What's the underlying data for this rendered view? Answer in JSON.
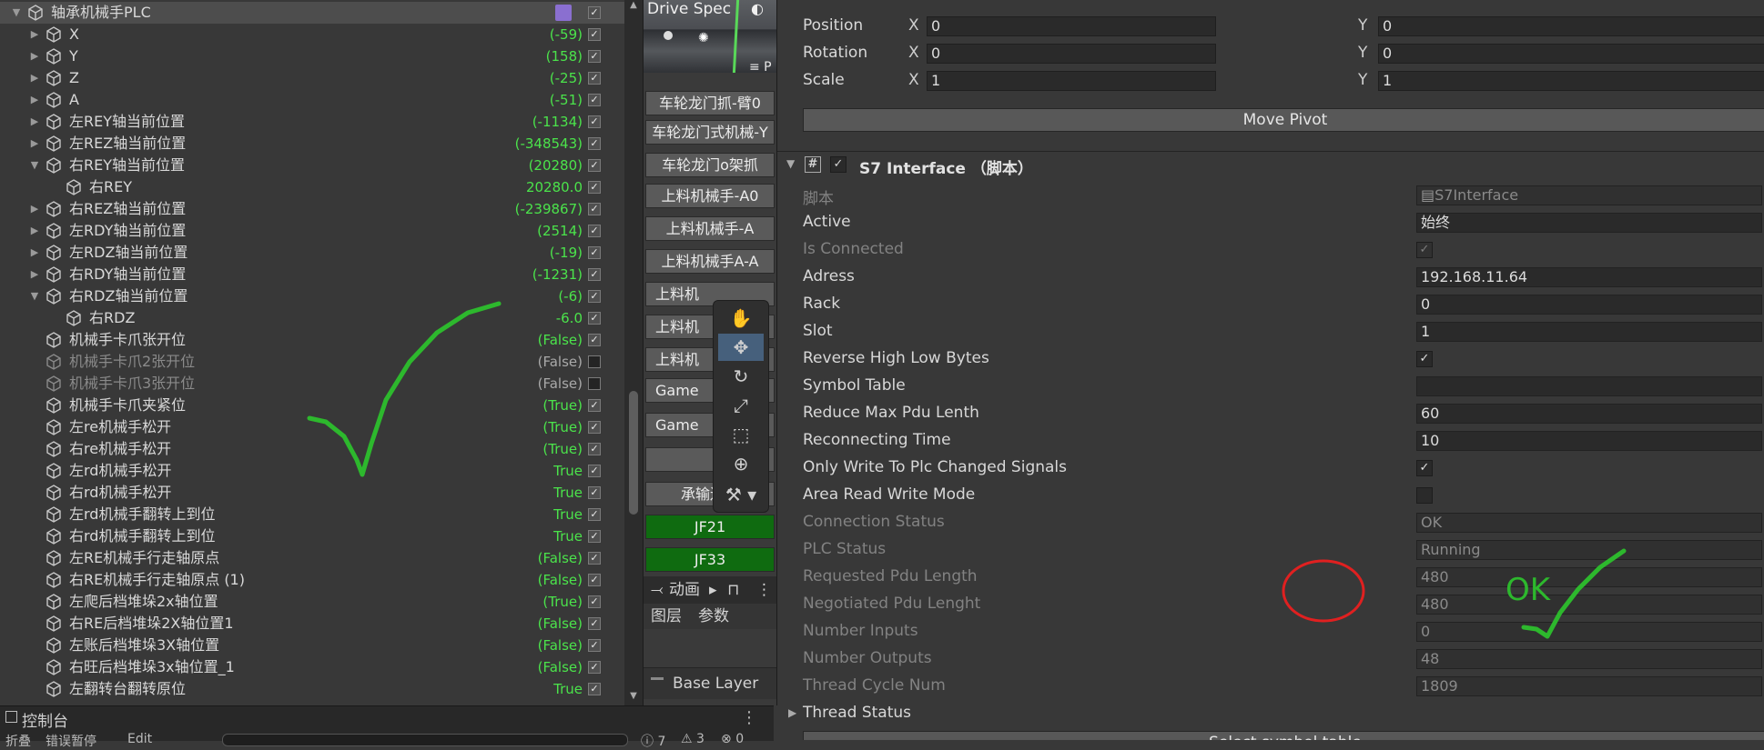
{
  "hierarchy": {
    "root": "轴承机械手PLC",
    "rows": [
      {
        "name": "X",
        "value": "(-59)",
        "checked": true,
        "depth": 1,
        "fold": "closed"
      },
      {
        "name": "Y",
        "value": "(158)",
        "checked": true,
        "depth": 1,
        "fold": "closed"
      },
      {
        "name": "Z",
        "value": "(-25)",
        "checked": true,
        "depth": 1,
        "fold": "closed"
      },
      {
        "name": "A",
        "value": "(-51)",
        "checked": true,
        "depth": 1,
        "fold": "closed"
      },
      {
        "name": "左REY轴当前位置",
        "value": "(-1134)",
        "checked": true,
        "depth": 1,
        "fold": "closed"
      },
      {
        "name": "左REZ轴当前位置",
        "value": "(-348543)",
        "checked": true,
        "depth": 1,
        "fold": "closed"
      },
      {
        "name": "右REY轴当前位置",
        "value": "(20280)",
        "checked": true,
        "depth": 1,
        "fold": "open"
      },
      {
        "name": "右REY",
        "value": "20280.0",
        "checked": true,
        "depth": 2,
        "fold": "none"
      },
      {
        "name": "右REZ轴当前位置",
        "value": "(-239867)",
        "checked": true,
        "depth": 1,
        "fold": "closed"
      },
      {
        "name": "左RDY轴当前位置",
        "value": "(2514)",
        "checked": true,
        "depth": 1,
        "fold": "closed"
      },
      {
        "name": "左RDZ轴当前位置",
        "value": "(-19)",
        "checked": true,
        "depth": 1,
        "fold": "closed"
      },
      {
        "name": "右RDY轴当前位置",
        "value": "(-1231)",
        "checked": true,
        "depth": 1,
        "fold": "closed"
      },
      {
        "name": "右RDZ轴当前位置",
        "value": "(-6)",
        "checked": true,
        "depth": 1,
        "fold": "open"
      },
      {
        "name": "右RDZ",
        "value": "-6.0",
        "checked": true,
        "depth": 2,
        "fold": "none"
      },
      {
        "name": "机械手卡爪张开位",
        "value": "(False)",
        "checked": true,
        "depth": 1,
        "fold": "none"
      },
      {
        "name": "机械手卡爪2张开位",
        "value": "(False)",
        "checked": false,
        "depth": 1,
        "fold": "none",
        "dim": true
      },
      {
        "name": "机械手卡爪3张开位",
        "value": "(False)",
        "checked": false,
        "depth": 1,
        "fold": "none",
        "dim": true
      },
      {
        "name": "机械手卡爪夹紧位",
        "value": "(True)",
        "checked": true,
        "depth": 1,
        "fold": "none"
      },
      {
        "name": "左re机械手松开",
        "value": "(True)",
        "checked": true,
        "depth": 1,
        "fold": "none"
      },
      {
        "name": "右re机械手松开",
        "value": "(True)",
        "checked": true,
        "depth": 1,
        "fold": "none"
      },
      {
        "name": "左rd机械手松开",
        "value": "True",
        "checked": true,
        "depth": 1,
        "fold": "none"
      },
      {
        "name": "右rd机械手松开",
        "value": "True",
        "checked": true,
        "depth": 1,
        "fold": "none"
      },
      {
        "name": "左rd机械手翻转上到位",
        "value": "True",
        "checked": true,
        "depth": 1,
        "fold": "none"
      },
      {
        "name": "右rd机械手翻转上到位",
        "value": "True",
        "checked": true,
        "depth": 1,
        "fold": "none"
      },
      {
        "name": "左RE机械手行走轴原点",
        "value": "(False)",
        "checked": true,
        "depth": 1,
        "fold": "none"
      },
      {
        "name": "右RE机械手行走轴原点 (1)",
        "value": "(False)",
        "checked": true,
        "depth": 1,
        "fold": "none"
      },
      {
        "name": "左爬后档堆垛2x轴位置",
        "value": "(True)",
        "checked": true,
        "depth": 1,
        "fold": "none"
      },
      {
        "name": "右RE后档堆垛2X轴位置1",
        "value": "(False)",
        "checked": true,
        "depth": 1,
        "fold": "none"
      },
      {
        "name": "左账后档堆垛3X轴位置",
        "value": "(False)",
        "checked": true,
        "depth": 1,
        "fold": "none"
      },
      {
        "name": "右旺后档堆垛3x轴位置_1",
        "value": "(False)",
        "checked": true,
        "depth": 1,
        "fold": "none"
      },
      {
        "name": "左翻转台翻转原位",
        "value": "True",
        "checked": true,
        "depth": 1,
        "fold": "none"
      }
    ]
  },
  "console": {
    "title": "控制台",
    "tools": [
      "折叠",
      "错误暂停",
      "Edit",
      "7",
      "3",
      "0"
    ]
  },
  "middle": {
    "scene_label": "Drive Spec",
    "scene_label2": "≡ P",
    "buttons": [
      "车轮龙门抓-臂0",
      "车轮龙门式机械-Y",
      "车轮龙门o架抓",
      "上料机械手-A0",
      "上料机械手-A",
      "上料机械手A-A",
      "上料机",
      "上料机",
      "上料机",
      "Game",
      "Game",
      "",
      "承输送线"
    ],
    "green_buttons": [
      "JF21",
      "JF33"
    ],
    "anim_title": "动画",
    "anim_tabs": [
      "图层",
      "参数"
    ],
    "base_layer": "Base Layer"
  },
  "inspector": {
    "transform": {
      "position": {
        "label": "Position",
        "x": "0",
        "y": "0"
      },
      "rotation": {
        "label": "Rotation",
        "x": "0",
        "y": "0"
      },
      "scale": {
        "label": "Scale",
        "x": "1",
        "y": "1"
      },
      "move_pivot": "Move Pivot"
    },
    "component_title": "S7 Interface （脚本）",
    "fields": [
      {
        "label": "脚本",
        "type": "text",
        "value": "S7Interface",
        "disabled": true
      },
      {
        "label": "Active",
        "type": "text",
        "value": "始终",
        "disabled": false
      },
      {
        "label": "Is Connected",
        "type": "check",
        "value": true,
        "disabled": true
      },
      {
        "label": "Adress",
        "type": "text",
        "value": "192.168.11.64",
        "disabled": false
      },
      {
        "label": "Rack",
        "type": "text",
        "value": "0",
        "disabled": false
      },
      {
        "label": "Slot",
        "type": "text",
        "value": "1",
        "disabled": false
      },
      {
        "label": "Reverse High Low Bytes",
        "type": "check",
        "value": true,
        "disabled": false
      },
      {
        "label": "Symbol Table",
        "type": "text",
        "value": "",
        "disabled": false
      },
      {
        "label": "Reduce Max Pdu Lenth",
        "type": "text",
        "value": "60",
        "disabled": false
      },
      {
        "label": "Reconnecting Time",
        "type": "text",
        "value": "10",
        "disabled": false
      },
      {
        "label": "Only Write To Plc Changed Signals",
        "type": "check",
        "value": true,
        "disabled": false
      },
      {
        "label": "Area Read Write Mode",
        "type": "check",
        "value": false,
        "disabled": false
      },
      {
        "label": "Connection Status",
        "type": "text",
        "value": "OK",
        "disabled": true
      },
      {
        "label": "PLC Status",
        "type": "text",
        "value": "Running",
        "disabled": true
      },
      {
        "label": "Requested Pdu Length",
        "type": "text",
        "value": "480",
        "disabled": true
      },
      {
        "label": "Negotiated Pdu Lenght",
        "type": "text",
        "value": "480",
        "disabled": true
      },
      {
        "label": "Number Inputs",
        "type": "text",
        "value": "0",
        "disabled": true
      },
      {
        "label": "Number Outputs",
        "type": "text",
        "value": "48",
        "disabled": true
      },
      {
        "label": "Thread Cycle Num",
        "type": "text",
        "value": "1809",
        "disabled": true
      }
    ],
    "thread_status": "Thread Status",
    "bottom_button": "Select symbol table"
  },
  "annotations": {
    "ok_text": "OK",
    "color": "#2db82d",
    "circle_color": "#e02020"
  },
  "colors": {
    "value_green": "#4be34b",
    "jf_green": "#0f6b10",
    "bg": "#383838"
  }
}
